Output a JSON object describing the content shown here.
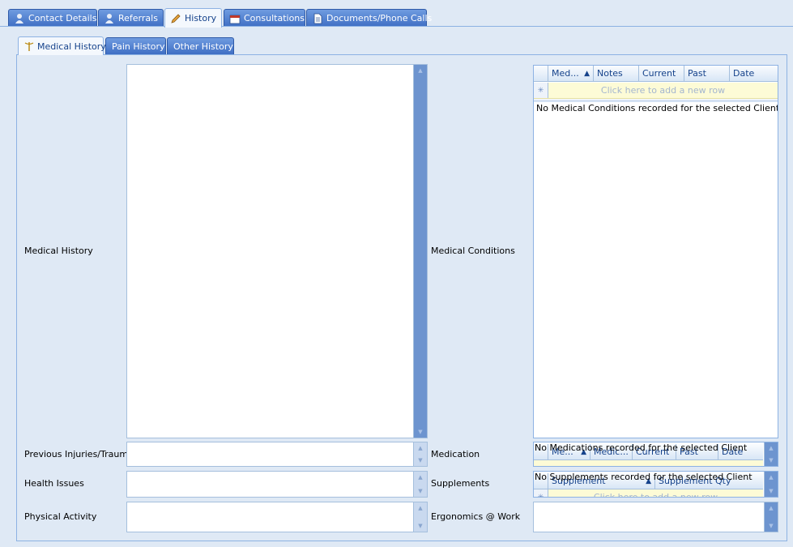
{
  "top_tabs": [
    {
      "label": "Contact Details",
      "icon": "person-icon"
    },
    {
      "label": "Referrals",
      "icon": "person-icon"
    },
    {
      "label": "History",
      "icon": "pencil-icon"
    },
    {
      "label": "Consultations",
      "icon": "calendar-icon"
    },
    {
      "label": "Documents/Phone Calls",
      "icon": "document-icon"
    }
  ],
  "active_top_tab": "History",
  "sub_tabs": [
    {
      "label": "Medical History",
      "icon": "caduceus-icon"
    },
    {
      "label": "Pain History"
    },
    {
      "label": "Other History"
    }
  ],
  "active_sub_tab": "Medical History",
  "fields": {
    "medical_history": "Medical History",
    "previous_injuries": "Previous Injuries/Trauma",
    "health_issues": "Health Issues",
    "physical_activity": "Physical Activity",
    "medical_conditions": "Medical Conditions",
    "medication": "Medication",
    "supplements": "Supplements",
    "ergonomics": "Ergonomics @ Work"
  },
  "conditions_grid": {
    "columns": [
      "Med...",
      "Notes",
      "Current",
      "Past",
      "Date"
    ],
    "sort_glyph": "▲",
    "new_row_text": "Click here to add a new row",
    "new_row_glyph": "✳",
    "empty_text": "No Medical Conditions recorded for the selected Client"
  },
  "medication_grid": {
    "columns": [
      "Me...",
      "Medic...",
      "Current",
      "Past",
      "Date"
    ],
    "sort_glyph": "▲",
    "empty_text": "No Medications recorded for the selected Client"
  },
  "supplements_grid": {
    "columns": [
      "Supplement",
      "Supplement Qty"
    ],
    "sort_glyph": "▲",
    "new_row_text": "Click here to add a new row",
    "new_row_glyph": "✳",
    "empty_text": "No Supplements recorded for the selected Client"
  },
  "colors": {
    "background": "#dfe9f5",
    "tab_blue": "#3f6fc4",
    "header_text": "#15428b",
    "new_row_bg": "#fdfbd6"
  }
}
